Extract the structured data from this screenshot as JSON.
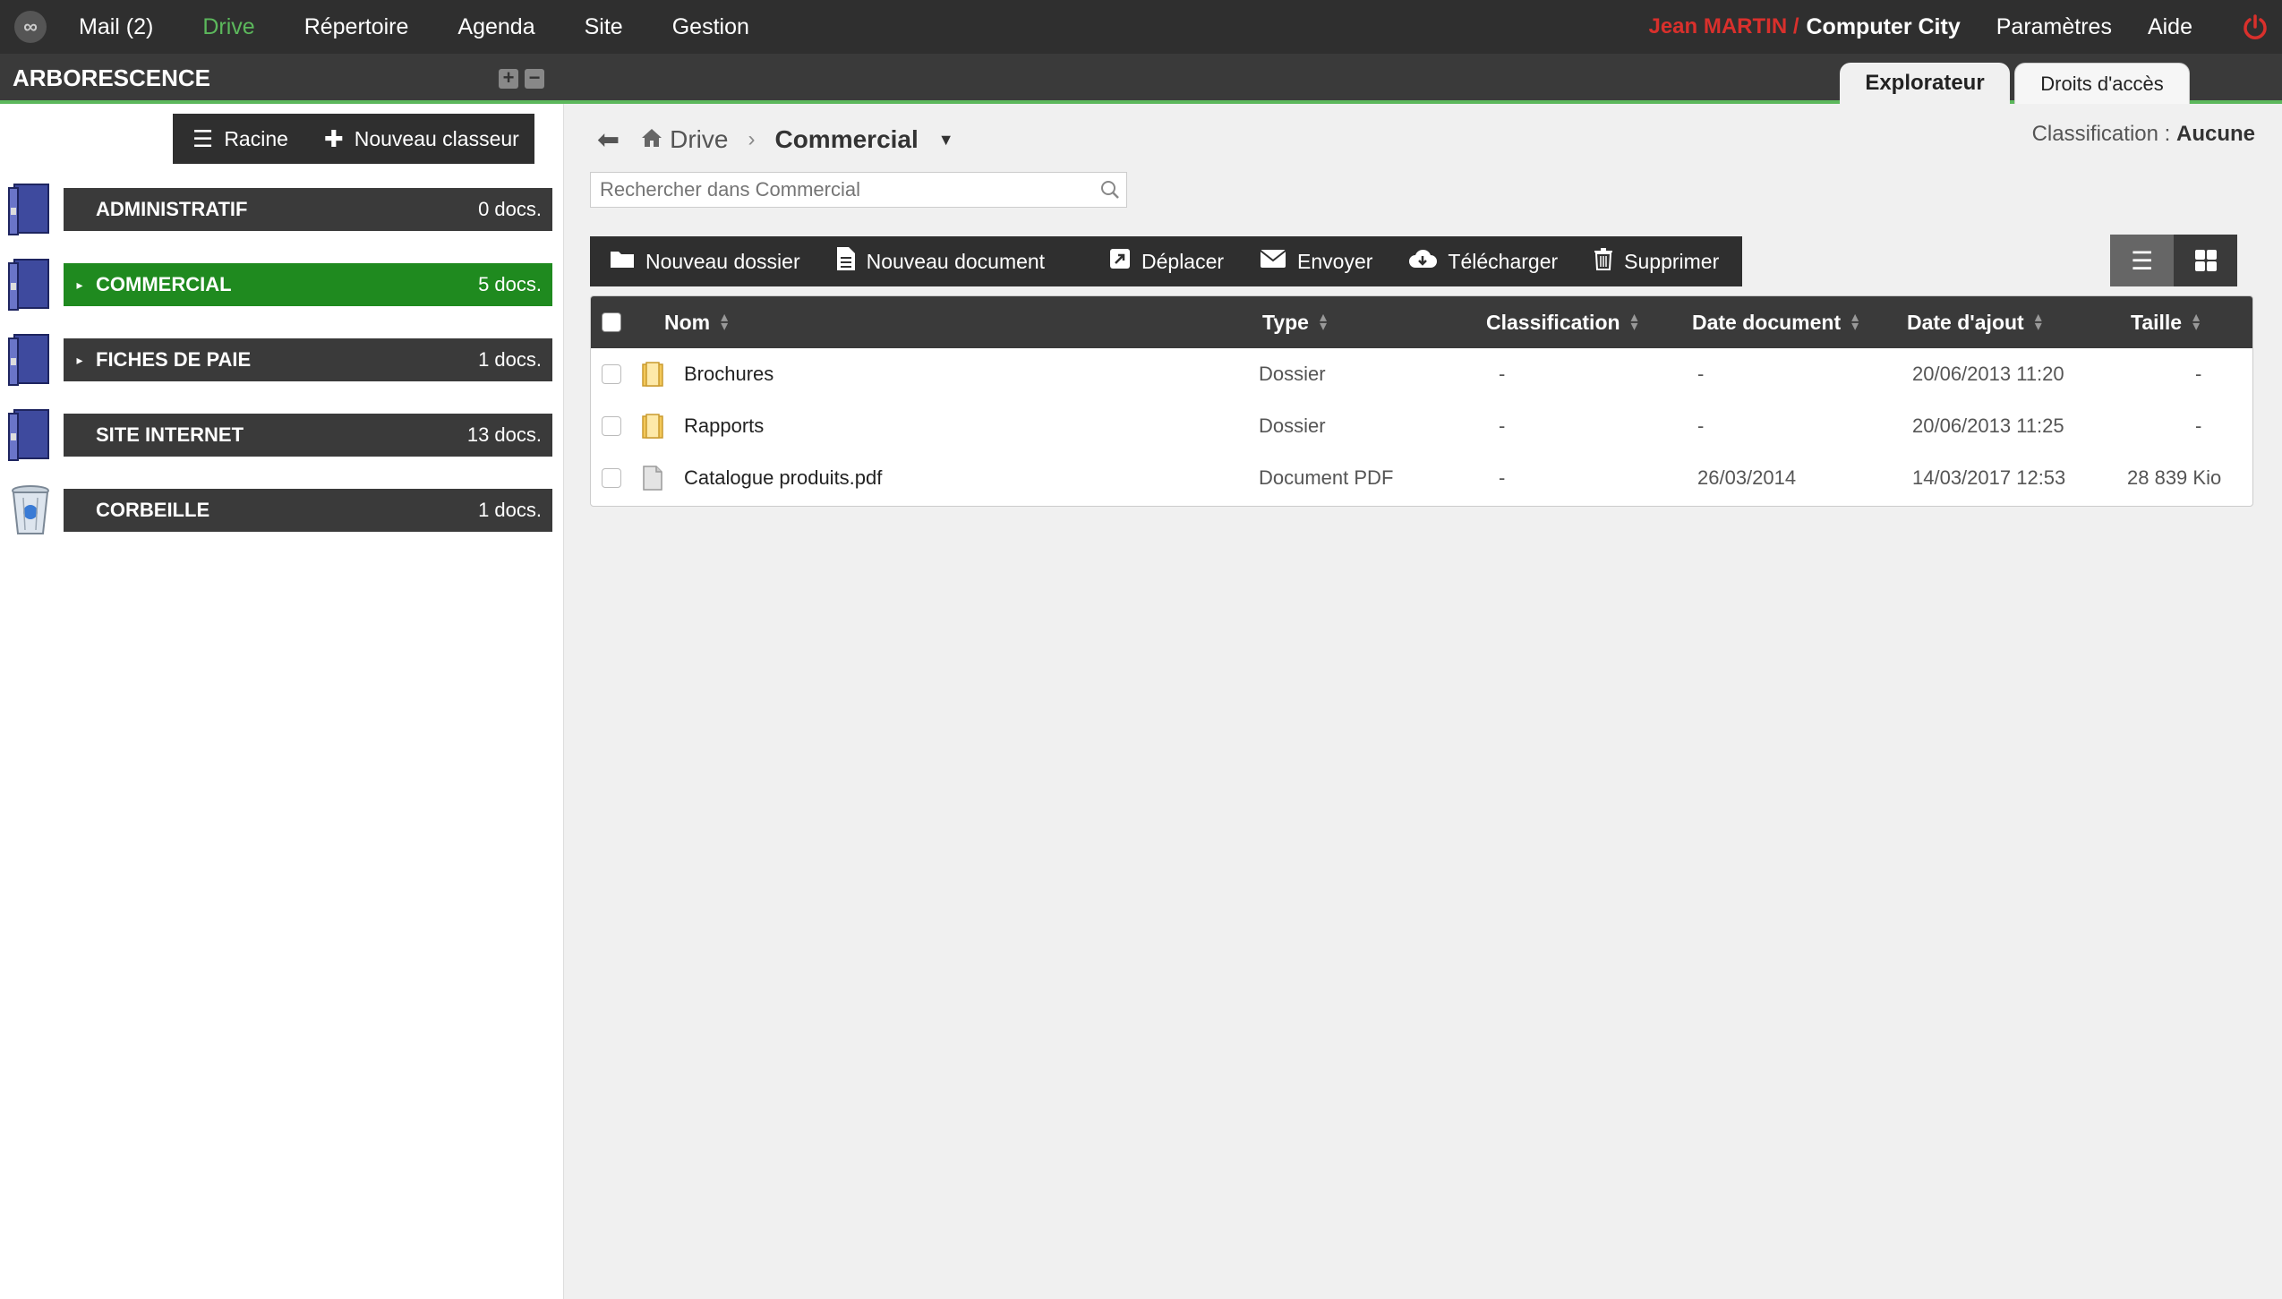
{
  "topnav": {
    "logo": "∞",
    "items": [
      "Mail (2)",
      "Drive",
      "Répertoire",
      "Agenda",
      "Site",
      "Gestion"
    ],
    "active_index": 1,
    "user_name": "Jean MARTIN /",
    "company": "Computer City",
    "settings": "Paramètres",
    "help": "Aide"
  },
  "subbar": {
    "tree_title": "ARBORESCENCE",
    "tabs": [
      "Explorateur",
      "Droits d'accès"
    ],
    "active_tab": 0
  },
  "left_toolbar": {
    "root_label": "Racine",
    "new_binder_label": "Nouveau classeur"
  },
  "folders": [
    {
      "name": "ADMINISTRATIF",
      "count": "0 docs.",
      "caret": "",
      "active": false
    },
    {
      "name": "COMMERCIAL",
      "count": "5 docs.",
      "caret": "▸",
      "active": true
    },
    {
      "name": "FICHES DE PAIE",
      "count": "1 docs.",
      "caret": "▸",
      "active": false
    },
    {
      "name": "SITE INTERNET",
      "count": "13 docs.",
      "caret": "",
      "active": false
    },
    {
      "name": "CORBEILLE",
      "count": "1 docs.",
      "caret": "",
      "active": false
    }
  ],
  "breadcrumb": {
    "root": "Drive",
    "current": "Commercial"
  },
  "classification": {
    "label": "Classification :",
    "value": "Aucune"
  },
  "search": {
    "placeholder": "Rechercher dans Commercial"
  },
  "toolbar": {
    "new_folder": "Nouveau dossier",
    "new_document": "Nouveau document",
    "move": "Déplacer",
    "send": "Envoyer",
    "download": "Télécharger",
    "delete": "Supprimer"
  },
  "table": {
    "headers": {
      "name": "Nom",
      "type": "Type",
      "classification": "Classification",
      "doc_date": "Date document",
      "added_date": "Date d'ajout",
      "size": "Taille"
    },
    "rows": [
      {
        "name": "Brochures",
        "type": "Dossier",
        "classification": "-",
        "doc_date": "-",
        "added_date": "20/06/2013 11:20",
        "size": "-",
        "kind": "folder"
      },
      {
        "name": "Rapports",
        "type": "Dossier",
        "classification": "-",
        "doc_date": "-",
        "added_date": "20/06/2013 11:25",
        "size": "-",
        "kind": "folder"
      },
      {
        "name": "Catalogue produits.pdf",
        "type": "Document PDF",
        "classification": "-",
        "doc_date": "26/03/2014",
        "added_date": "14/03/2017 12:53",
        "size": "28 839 Kio",
        "kind": "file"
      }
    ]
  },
  "colors": {
    "accent_green": "#5cb85c",
    "active_folder": "#1f8a1f",
    "user_red": "#d9302c",
    "dark_bar": "#2f2f2f"
  }
}
